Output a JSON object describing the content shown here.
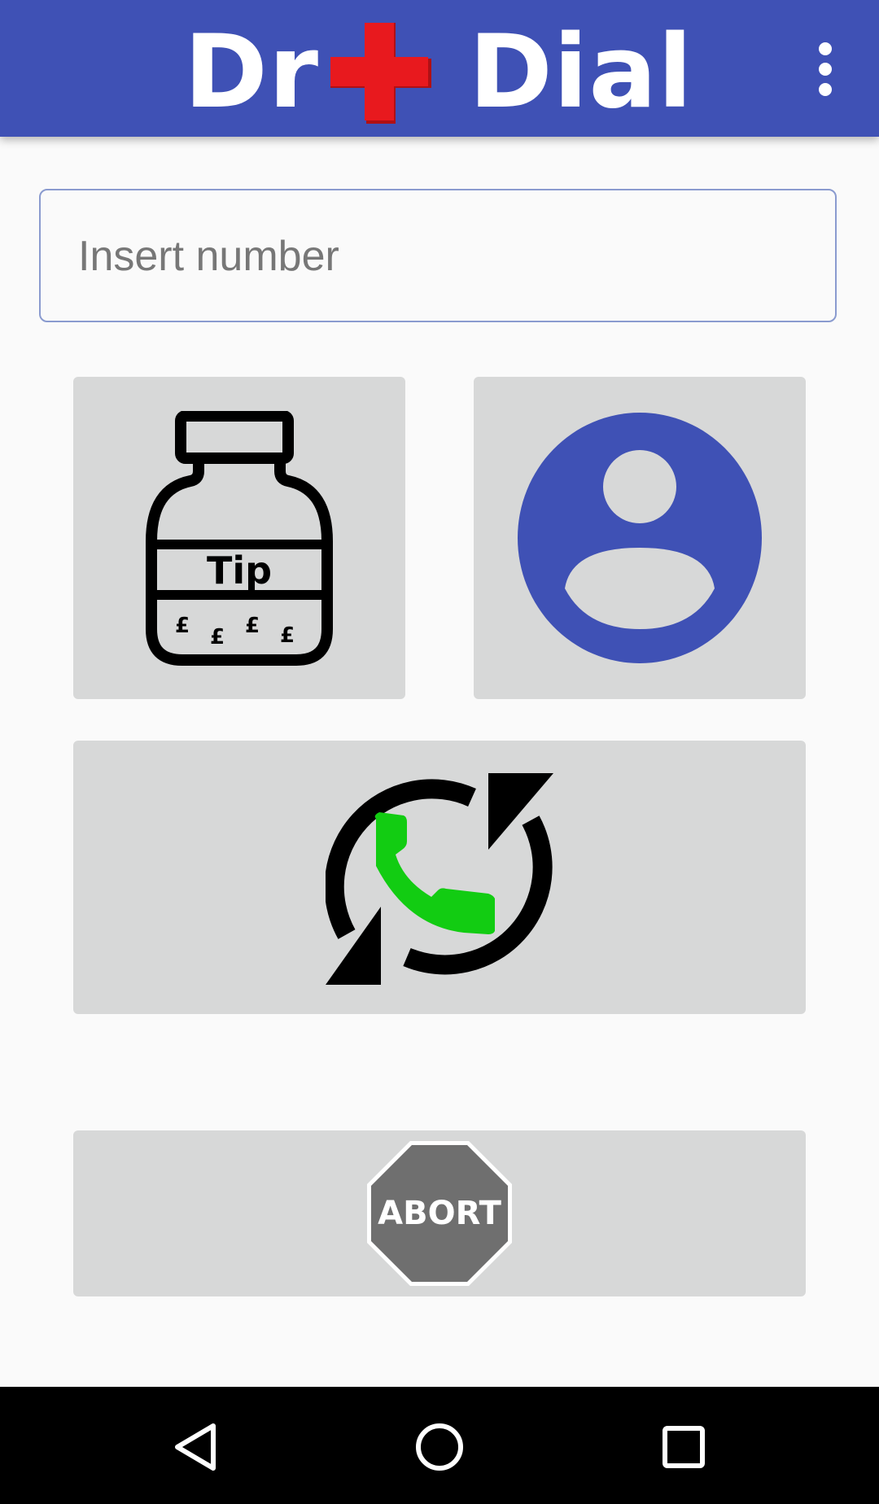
{
  "app_bar": {
    "title_left": "Dr",
    "title_right": "Dial",
    "cross_color": "#e8191e",
    "background_color": "#3f51b5",
    "overflow_icon": "more-vert-icon"
  },
  "search": {
    "placeholder": "Insert number",
    "value": ""
  },
  "tiles": {
    "tip": {
      "label": "Tip",
      "coin_symbols": [
        "£",
        "£",
        "£",
        "£"
      ],
      "icon": "tip-jar-icon"
    },
    "contact": {
      "icon": "contact-avatar-icon",
      "color": "#3f51b5"
    },
    "redial": {
      "icon": "redial-phone-icon",
      "phone_color": "#12cc12"
    },
    "abort": {
      "label": "ABORT",
      "icon": "stop-sign-icon",
      "color": "#6f6f6f"
    }
  },
  "nav": {
    "back_icon": "back-triangle-icon",
    "home_icon": "home-circle-icon",
    "recents_icon": "recents-square-icon"
  }
}
